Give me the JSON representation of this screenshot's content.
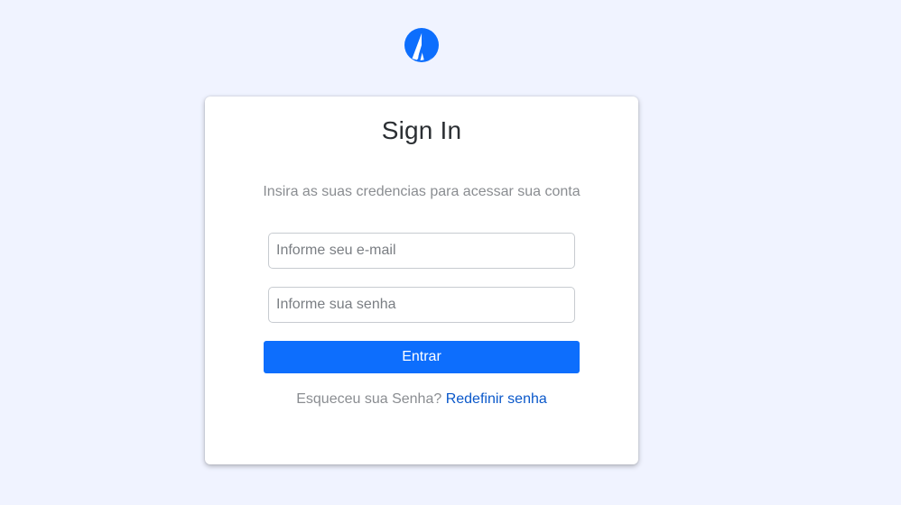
{
  "colors": {
    "background": "#f0f3ff",
    "brand": "#0d6efd",
    "link": "#0a58ca"
  },
  "logo": {
    "icon": "brand-logo-icon"
  },
  "signin": {
    "title": "Sign In",
    "subtitle": "Insira as suas credencias para acessar sua conta",
    "email": {
      "placeholder": "Informe seu e-mail",
      "value": ""
    },
    "password": {
      "placeholder": "Informe sua senha",
      "value": ""
    },
    "submit_label": "Entrar",
    "forgot_text": "Esqueceu sua Senha?",
    "reset_link": "Redefinir senha"
  }
}
